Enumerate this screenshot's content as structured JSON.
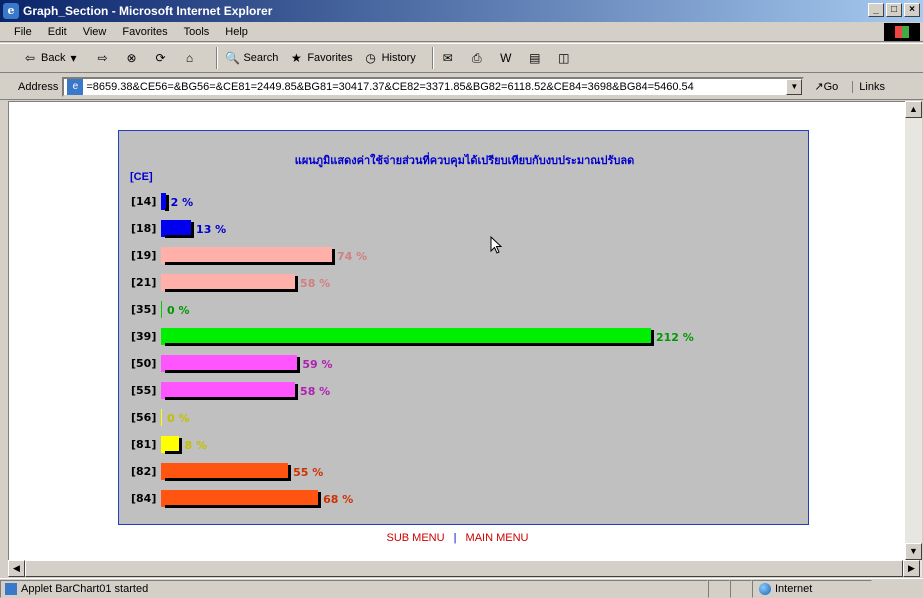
{
  "window": {
    "title": "Graph_Section - Microsoft Internet Explorer",
    "min_glyph": "_",
    "max_glyph": "□",
    "close_glyph": "×"
  },
  "menu": [
    "File",
    "Edit",
    "View",
    "Favorites",
    "Tools",
    "Help"
  ],
  "toolbar": {
    "back": "Back",
    "search": "Search",
    "favorites": "Favorites",
    "history": "History"
  },
  "address": {
    "label": "Address",
    "url": "=8659.38&CE56=&BG56=&CE81=2449.85&BG81=30417.37&CE82=3371.85&BG82=6118.52&CE84=3698&BG84=5460.54",
    "go": "Go",
    "links": "Links"
  },
  "chart_data": {
    "type": "bar",
    "orientation": "horizontal",
    "title": "แผนภูมิแสดงค่าใช้จ่ายส่วนที่ควบคุมได้เปรียบเทียบกับงบประมาณปรับลด",
    "axis_title": "[CE]",
    "background": "#c0c0c0",
    "categories": [
      "[14]",
      "[18]",
      "[19]",
      "[21]",
      "[35]",
      "[39]",
      "[50]",
      "[55]",
      "[56]",
      "[81]",
      "[82]",
      "[84]"
    ],
    "values": [
      2,
      13,
      74,
      58,
      0,
      212,
      59,
      58,
      0,
      8,
      55,
      68
    ],
    "value_labels": [
      "2 %",
      "13 %",
      "74 %",
      "58 %",
      "0 %",
      "212 %",
      "59 %",
      "58 %",
      "0 %",
      "8 %",
      "55 %",
      "68 %"
    ],
    "colors": [
      "#0000ee",
      "#0000ee",
      "#ffb0a8",
      "#ffb0a8",
      "#00cc00",
      "#00ee00",
      "#ff55ff",
      "#ff55ff",
      "#ffff00",
      "#ffff00",
      "#ff5511",
      "#ff5511"
    ],
    "label_colors": [
      "#0000cc",
      "#0000cc",
      "#d08080",
      "#d08080",
      "#009900",
      "#009900",
      "#b020b0",
      "#b020b0",
      "#c0c000",
      "#c0c000",
      "#cc3300",
      "#cc3300"
    ],
    "xlim": [
      0,
      212
    ]
  },
  "footer": {
    "sub_menu": "SUB MENU",
    "separator": "|",
    "main_menu": "MAIN MENU"
  },
  "status": {
    "text": "Applet BarChart01 started",
    "zone": "Internet"
  }
}
